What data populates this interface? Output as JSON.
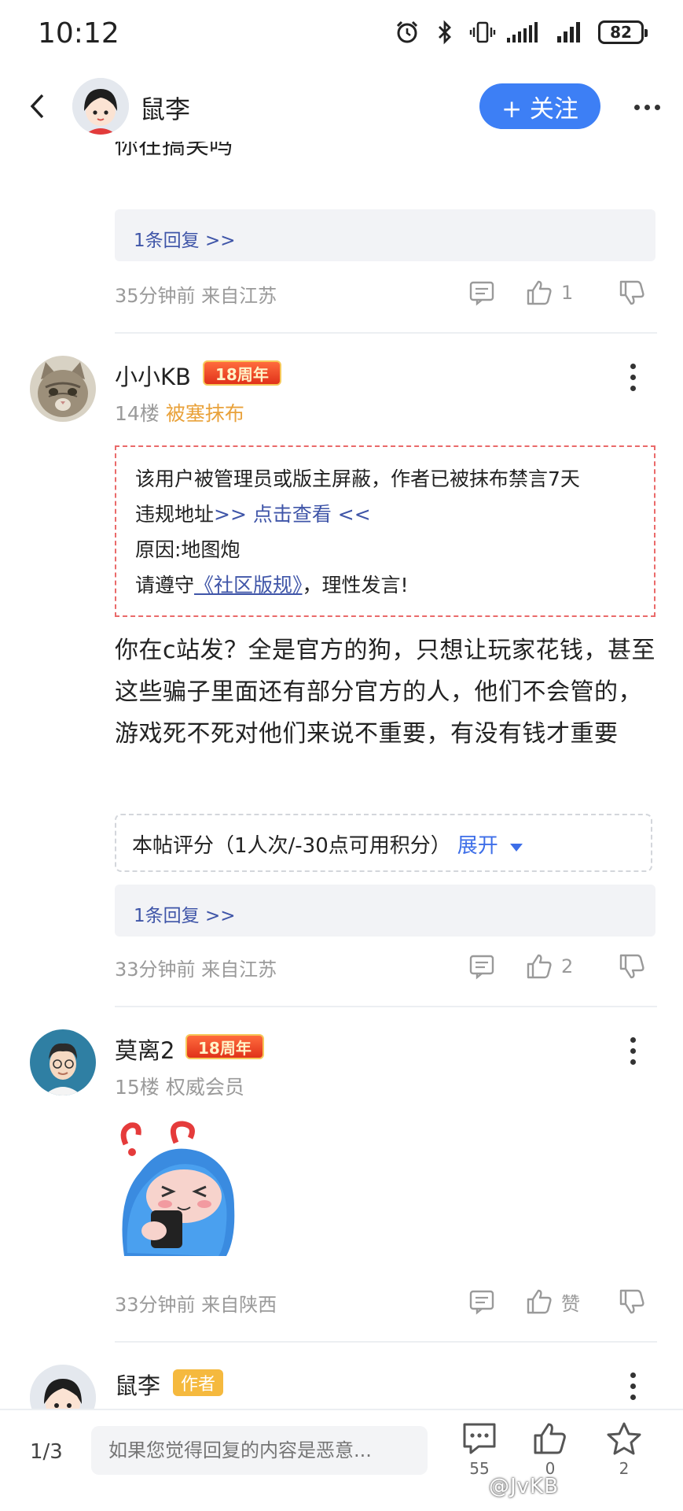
{
  "status_bar": {
    "time": "10:12",
    "battery": "82"
  },
  "header": {
    "back_icon": "chevron-left-icon",
    "user_name": "鼠李",
    "follow_label": "+ 关注",
    "more_icon": "more-horizontal-icon"
  },
  "posts": [
    {
      "partial_text": "你在搞笑吗",
      "reply_link": "1条回复 >>",
      "meta": "35分钟前 来自江苏",
      "likes": "1"
    },
    {
      "user_name": "小小KB",
      "badge": "18周年",
      "floor": "14楼",
      "status_tag": "被塞抹布",
      "notice": {
        "line1": "该用户被管理员或版主屏蔽，作者已被抹布禁言7天",
        "line2_prefix": "违规地址",
        "line2_link": ">> 点击查看 <<",
        "line3": "原因:地图炮",
        "line4_prefix": "请遵守",
        "line4_link": "《社区版规》",
        "line4_suffix": "，理性发言!"
      },
      "body": "你在c站发？全是官方的狗，只想让玩家花钱，甚至这些骗子里面还有部分官方的人，他们不会管的，游戏死不死对他们来说不重要，有没有钱才重要",
      "rating_text": "本帖评分（1人次/-30点可用积分）",
      "rating_expand": "展开",
      "reply_link": "1条回复 >>",
      "meta": "33分钟前 来自江苏",
      "likes": "2"
    },
    {
      "user_name": "莫离2",
      "badge": "18周年",
      "floor": "15楼",
      "member_tag": "权威会员",
      "meta": "33分钟前 来自陕西",
      "like_label": "赞"
    },
    {
      "user_name": "鼠李",
      "author_tag": "作者"
    }
  ],
  "bottom_bar": {
    "page_indicator": "1/3",
    "input_placeholder": "如果您觉得回复的内容是恶意...",
    "comments_count": "55",
    "likes_count": "0",
    "favorites_count": "2"
  },
  "watermark": "@JvKB",
  "colors": {
    "accent_blue": "#3d7ff5",
    "link_blue": "#3f55a8",
    "tag_orange": "#e9a23b",
    "notice_red": "#ea6a6a"
  }
}
